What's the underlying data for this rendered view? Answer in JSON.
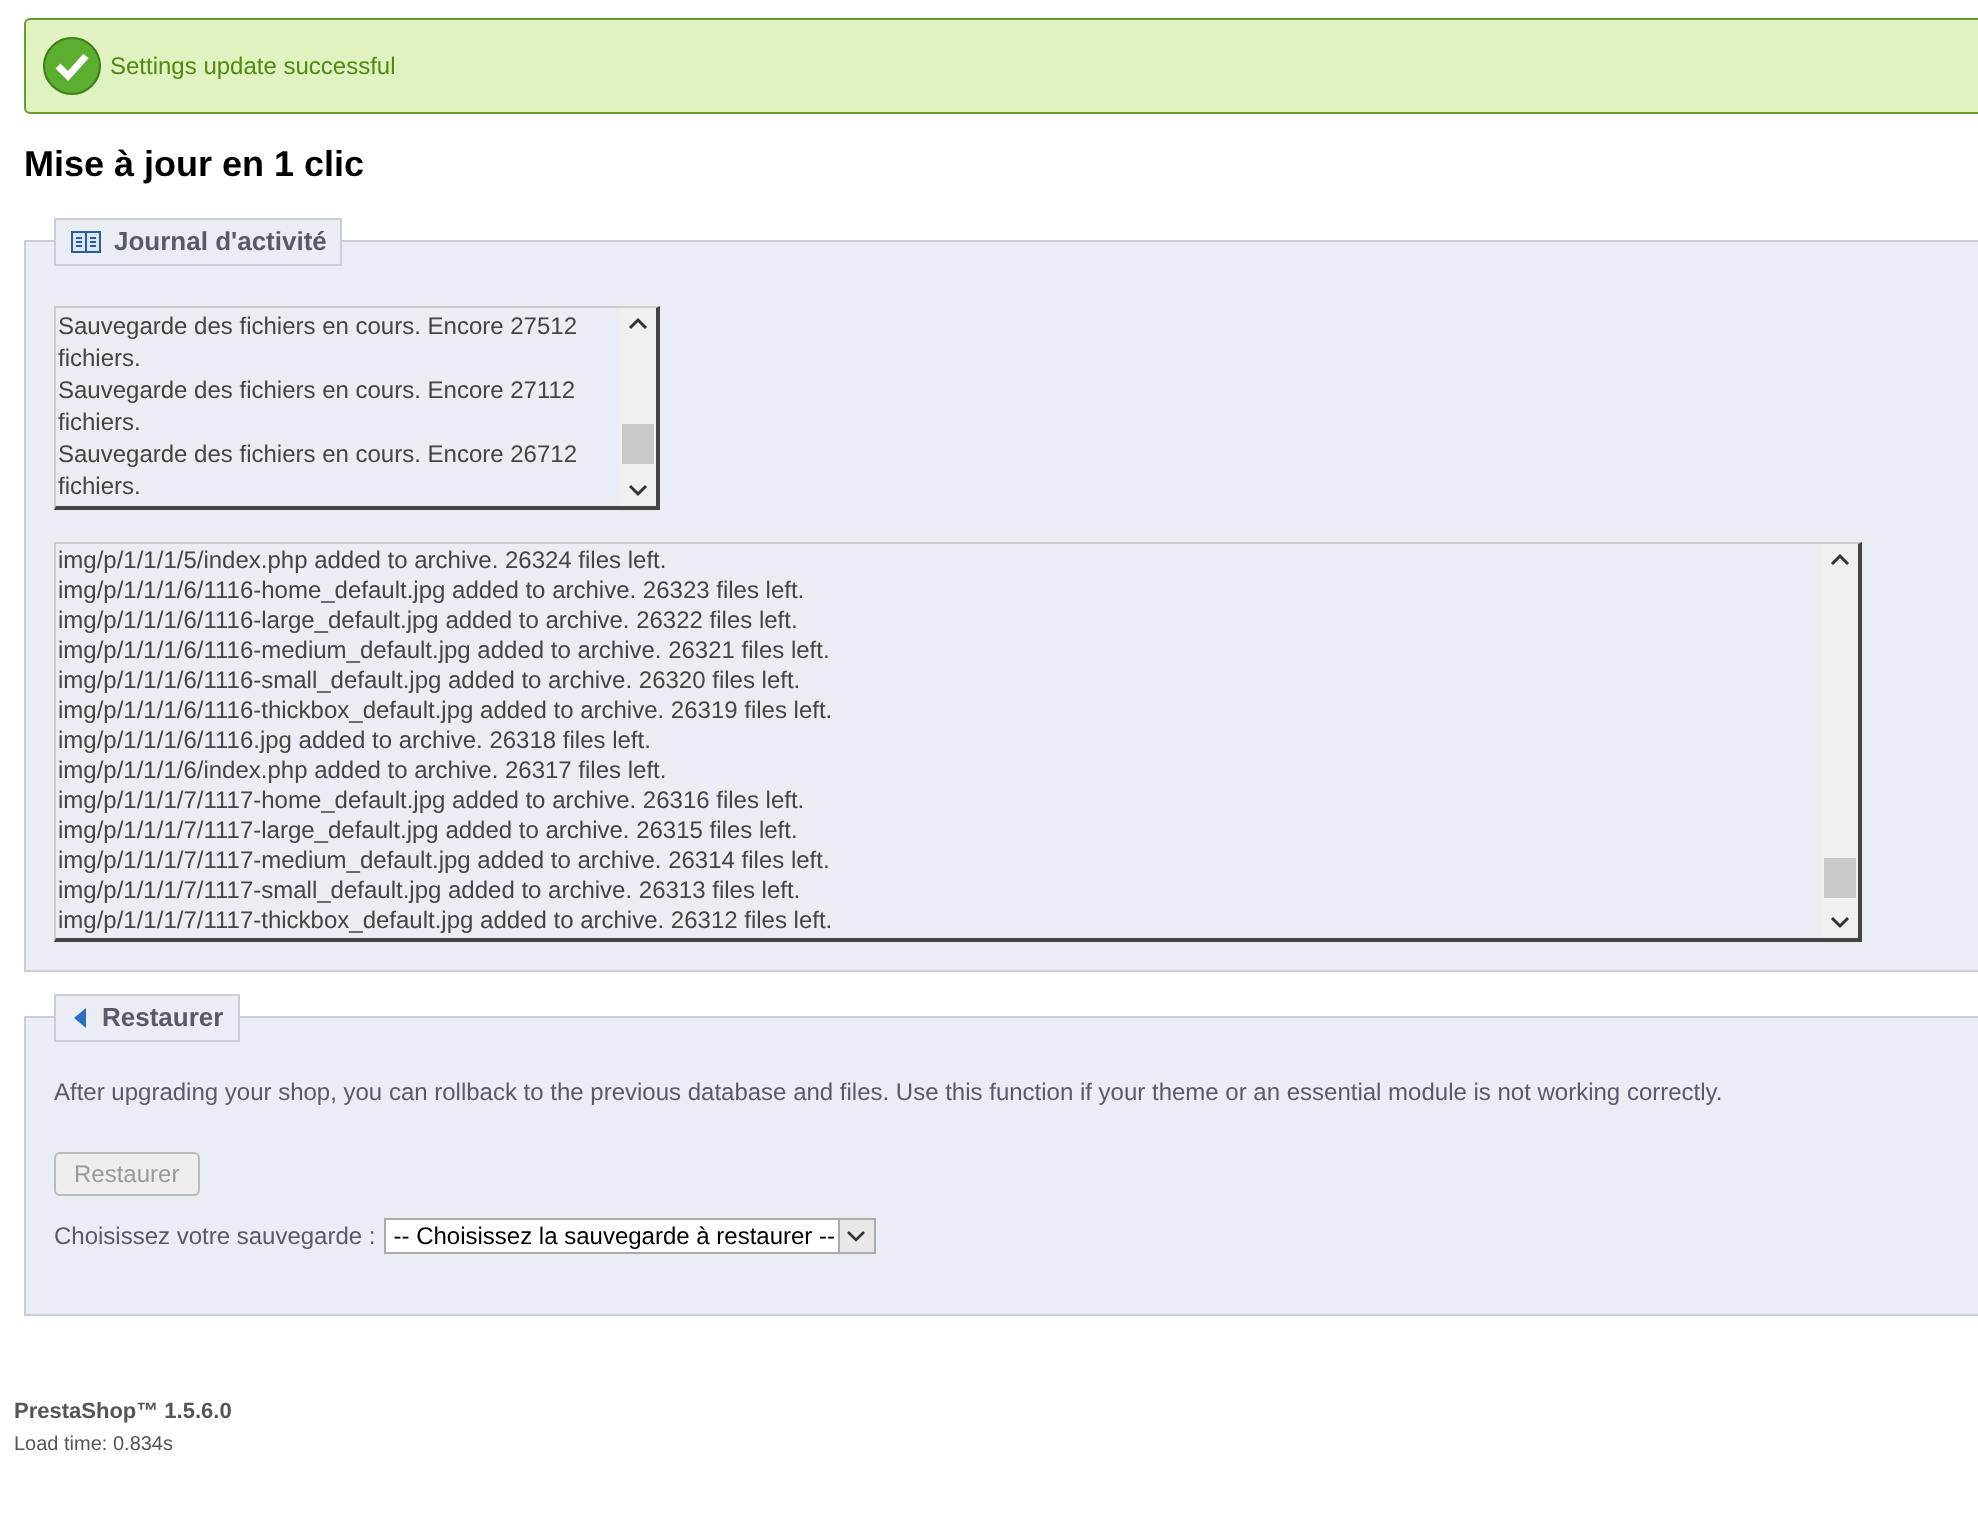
{
  "alert": {
    "text": "Settings update successful"
  },
  "title": "Mise à jour en 1 clic",
  "activity": {
    "legend": "Journal d'activité",
    "short_log": [
      "Sauvegarde des fichiers en cours. Encore 27512 fichiers.",
      "Sauvegarde des fichiers en cours. Encore 27112 fichiers.",
      "Sauvegarde des fichiers en cours. Encore 26712 fichiers."
    ],
    "long_log": [
      "img/p/1/1/1/5/index.php added to archive. 26324 files left.",
      "img/p/1/1/1/6/1116-home_default.jpg added to archive. 26323 files left.",
      "img/p/1/1/1/6/1116-large_default.jpg added to archive. 26322 files left.",
      "img/p/1/1/1/6/1116-medium_default.jpg added to archive. 26321 files left.",
      "img/p/1/1/1/6/1116-small_default.jpg added to archive. 26320 files left.",
      "img/p/1/1/1/6/1116-thickbox_default.jpg added to archive. 26319 files left.",
      "img/p/1/1/1/6/1116.jpg added to archive. 26318 files left.",
      "img/p/1/1/1/6/index.php added to archive. 26317 files left.",
      "img/p/1/1/1/7/1117-home_default.jpg added to archive. 26316 files left.",
      "img/p/1/1/1/7/1117-large_default.jpg added to archive. 26315 files left.",
      "img/p/1/1/1/7/1117-medium_default.jpg added to archive. 26314 files left.",
      "img/p/1/1/1/7/1117-small_default.jpg added to archive. 26313 files left.",
      "img/p/1/1/1/7/1117-thickbox_default.jpg added to archive. 26312 files left."
    ]
  },
  "restore": {
    "legend": "Restaurer",
    "description": "After upgrading your shop, you can rollback to the previous database and files. Use this function if your theme or an essential module is not working correctly.",
    "button": {
      "label": "Restaurer",
      "disabled": true
    },
    "select_label": "Choisissez votre sauvegarde :",
    "select_value": "-- Choisissez la sauvegarde à restaurer --"
  },
  "footer": {
    "version": "PrestaShop™ 1.5.6.0",
    "load_time": "Load time: 0.834s"
  }
}
